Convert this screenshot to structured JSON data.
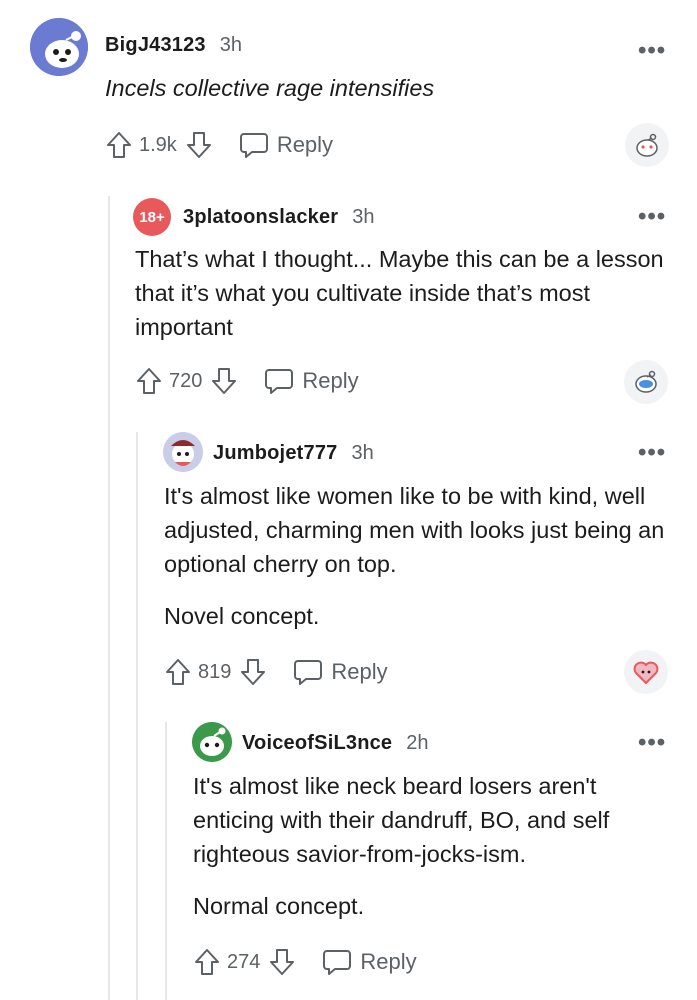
{
  "comments": [
    {
      "username": "BigJ43123",
      "time": "3h",
      "text": [
        "Incels collective rage intensifies"
      ],
      "votes": "1.9k",
      "reply_label": "Reply"
    },
    {
      "badge": "18+",
      "username": "3platoonslacker",
      "time": "3h",
      "text": [
        "That’s what I thought... Maybe this can be a lesson that it’s what you cultivate inside that’s most important"
      ],
      "votes": "720",
      "reply_label": "Reply"
    },
    {
      "username": "Jumbojet777",
      "time": "3h",
      "text": [
        "It's almost like women like to be with kind, well adjusted, charming men with looks just being an optional cherry on top.",
        "Novel concept."
      ],
      "votes": "819",
      "reply_label": "Reply"
    },
    {
      "username": "VoiceofSiL3nce",
      "time": "2h",
      "text": [
        "It's almost like neck beard losers aren't enticing with their dandruff, BO, and self righteous savior-from-jocks-ism.",
        "Normal concept."
      ],
      "votes": "274",
      "reply_label": "Reply"
    }
  ],
  "more_glyph": "•••",
  "colors": {
    "meta": "#5c6166",
    "nsfw": "#e8595b",
    "line": "#e5e7ea",
    "avatar_blue": "#6a7bd1",
    "avatar_green": "#3a9a4a"
  }
}
